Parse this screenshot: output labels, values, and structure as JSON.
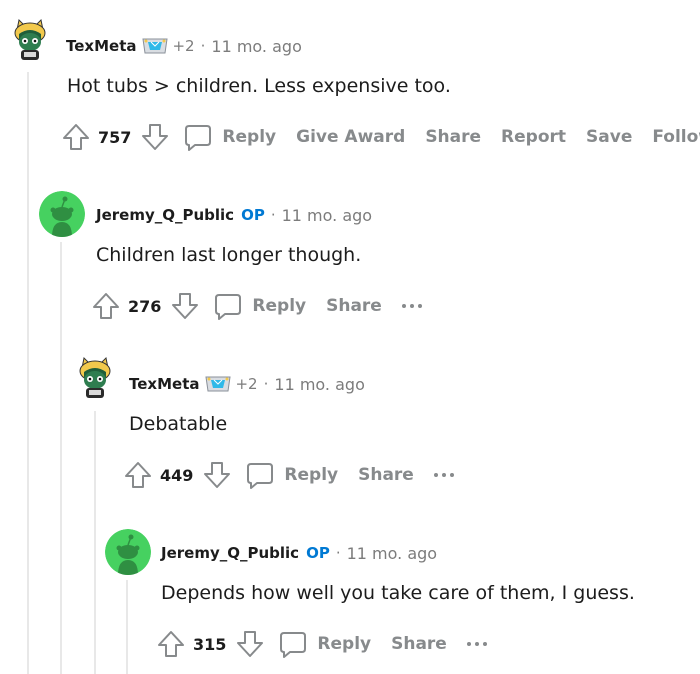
{
  "comments": [
    {
      "username": "TexMeta",
      "flair_icon": "award-gem-icon",
      "plus": "+2",
      "separator": "·",
      "time": "11 mo. ago",
      "body": "Hot tubs > children. Less expensive too.",
      "score": "757",
      "actions": [
        "Reply",
        "Give Award",
        "Share",
        "Report",
        "Save",
        "Follow"
      ]
    },
    {
      "username": "Jeremy_Q_Public",
      "op": "OP",
      "separator": "·",
      "time": "11 mo. ago",
      "body": "Children last longer though.",
      "score": "276",
      "actions": [
        "Reply",
        "Share"
      ]
    },
    {
      "username": "TexMeta",
      "flair_icon": "award-gem-icon",
      "plus": "+2",
      "separator": "·",
      "time": "11 mo. ago",
      "body": "Debatable",
      "score": "449",
      "actions": [
        "Reply",
        "Share"
      ]
    },
    {
      "username": "Jeremy_Q_Public",
      "op": "OP",
      "separator": "·",
      "time": "11 mo. ago",
      "body": "Depends how well you take care of them, I guess.",
      "score": "315",
      "actions": [
        "Reply",
        "Share"
      ]
    }
  ],
  "colors": {
    "op_blue": "#0079d3",
    "action_gray": "#878a8c",
    "meta_gray": "#7c7c7c",
    "snoo_green": "#46d160",
    "thread_line": "#e8e8e8"
  }
}
